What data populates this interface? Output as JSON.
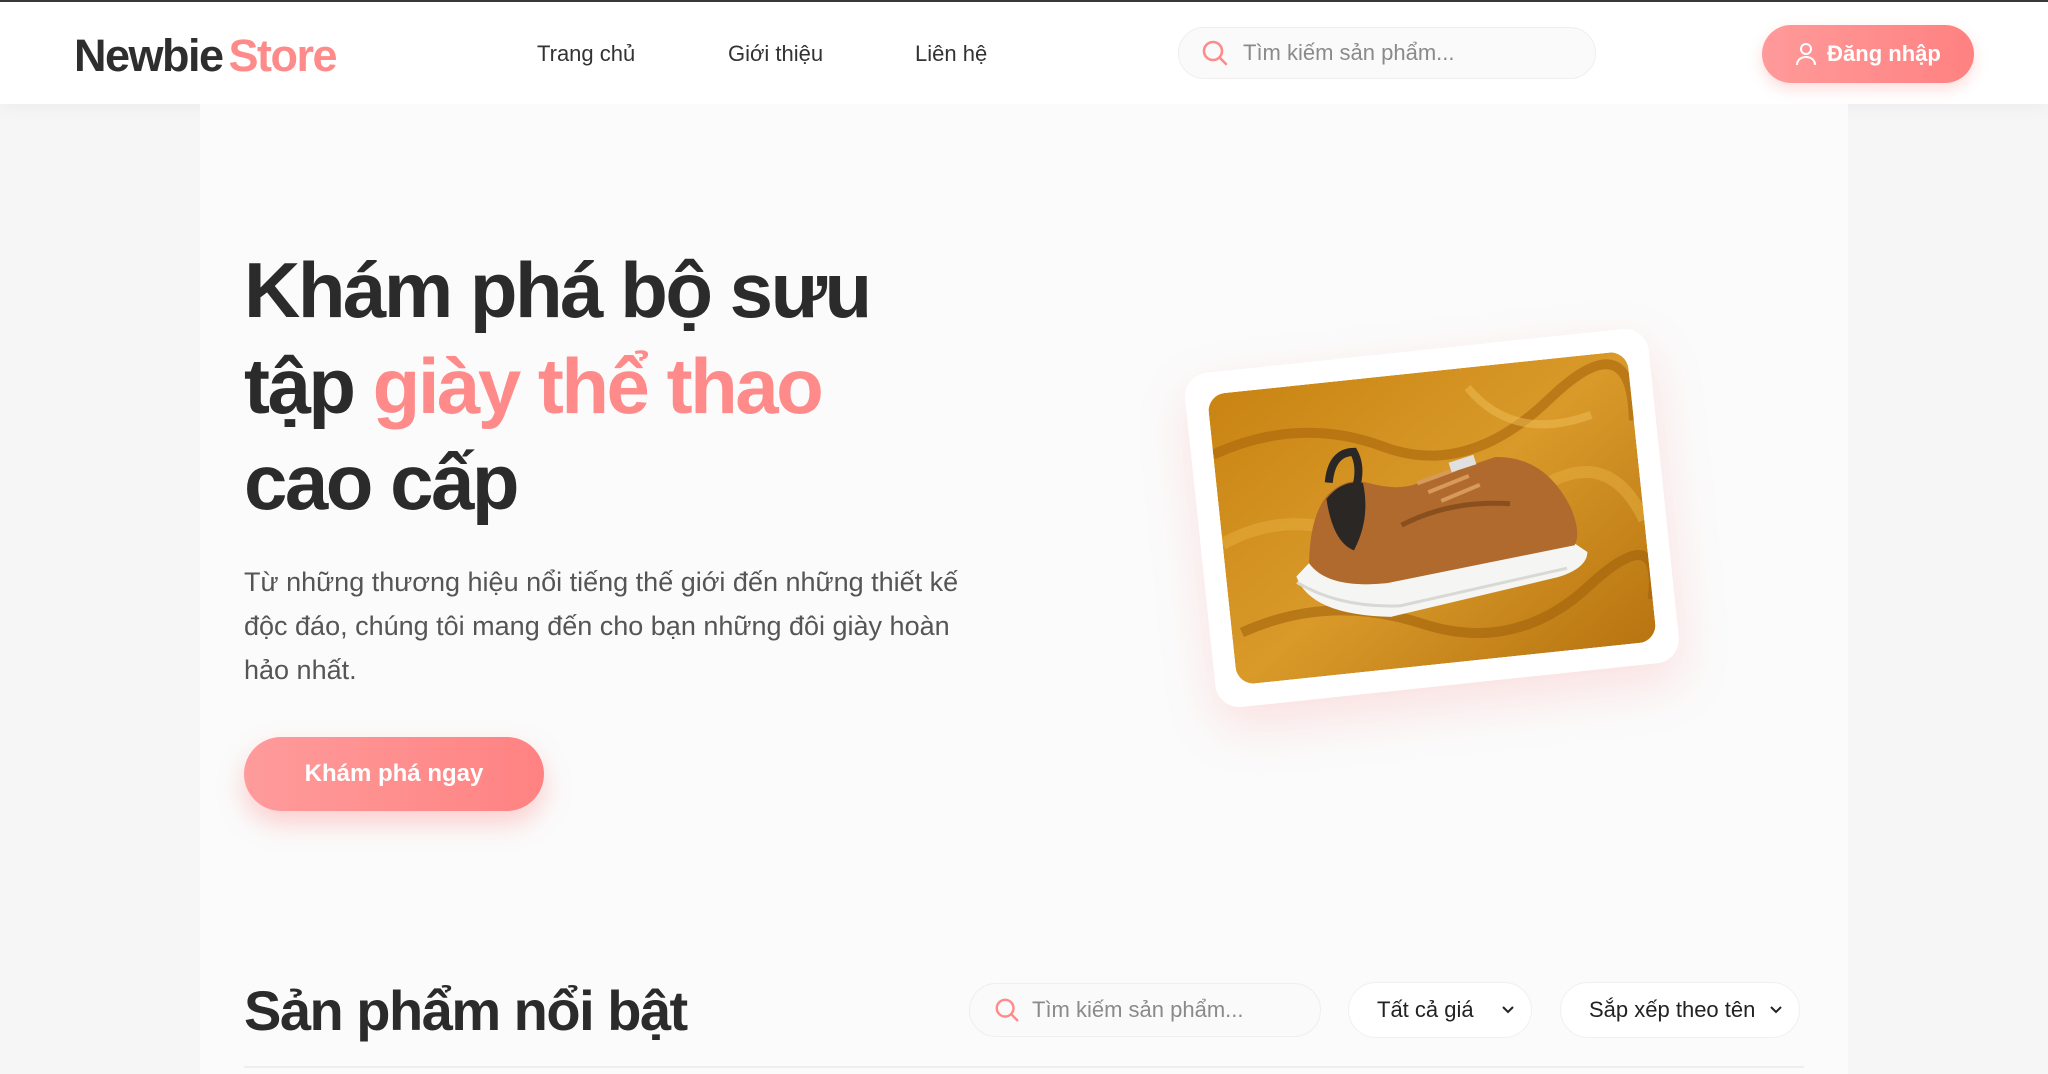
{
  "brand": {
    "name_part1": "Newbie",
    "name_part2": "Store"
  },
  "nav": {
    "items": [
      {
        "label": "Trang chủ"
      },
      {
        "label": "Giới thiệu"
      },
      {
        "label": "Liên hệ"
      }
    ]
  },
  "header_search": {
    "placeholder": "Tìm kiếm sản phẩm..."
  },
  "login": {
    "label": "Đăng nhập"
  },
  "hero": {
    "title_line1": "Khám phá bộ sưu",
    "title_line2_prefix": "tập ",
    "title_highlight": "giày thể thao",
    "title_line3": "cao cấp",
    "description": "Từ những thương hiệu nổi tiếng thế giới đến những thiết kế độc đáo, chúng tôi mang đến cho bạn những đôi giày hoàn hảo nhất.",
    "cta_label": "Khám phá ngay"
  },
  "featured": {
    "title": "Sản phẩm nổi bật",
    "search_placeholder": "Tìm kiếm sản phẩm...",
    "price_filter": "Tất cả giá",
    "sort": "Sắp xếp theo tên"
  },
  "colors": {
    "accent": "#ff8a8a",
    "text": "#2b2b2b"
  }
}
